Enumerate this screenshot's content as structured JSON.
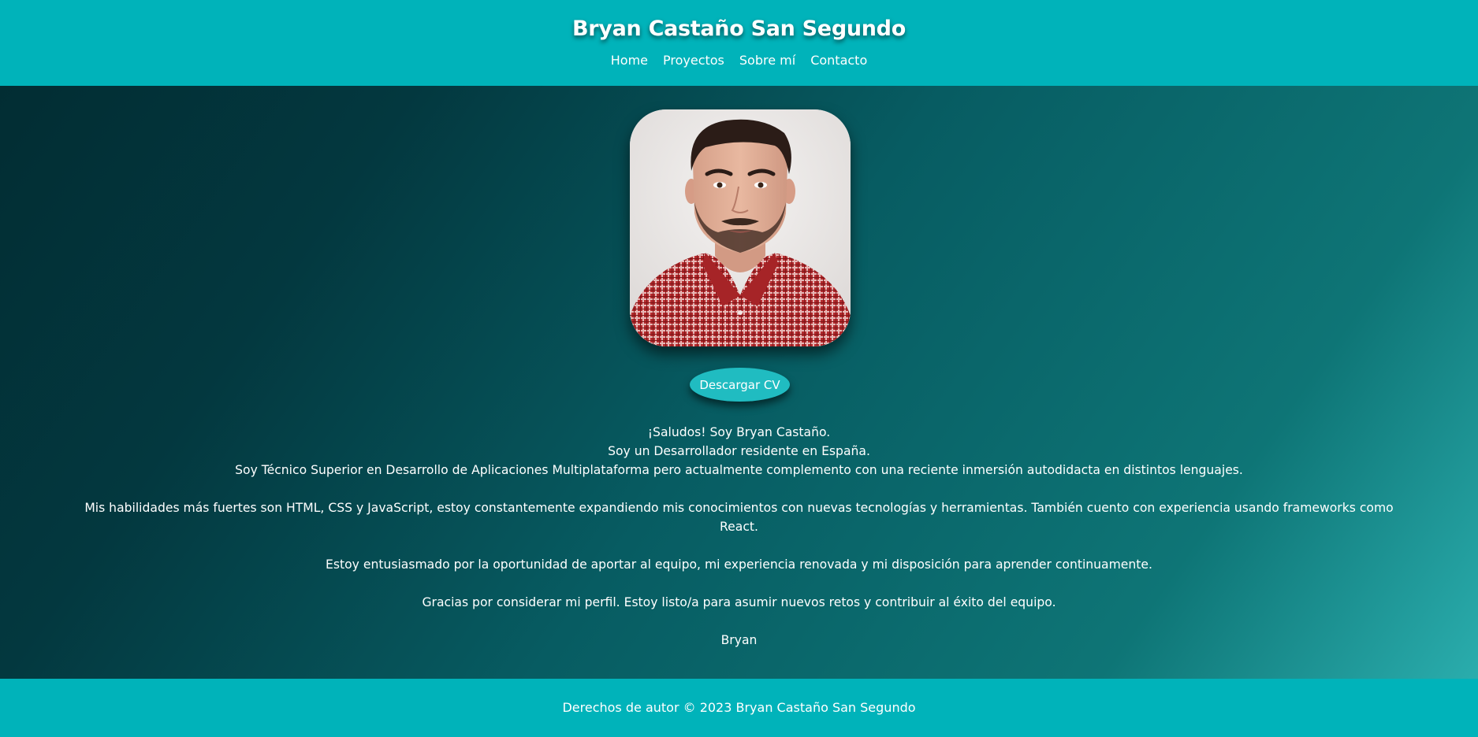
{
  "header": {
    "title": "Bryan Castaño San Segundo",
    "nav": [
      "Home",
      "Proyectos",
      "Sobre mí",
      "Contacto"
    ]
  },
  "main": {
    "cv_button": "Descargar CV",
    "intro": [
      "¡Saludos! Soy Bryan Castaño.",
      "Soy un Desarrollador residente en España.",
      "Soy Técnico Superior en Desarrollo de Aplicaciones Multiplataforma pero actualmente complemento con una reciente inmersión autodidacta en distintos lenguajes."
    ],
    "skills": "Mis habilidades más fuertes son HTML, CSS y JavaScript, estoy constantemente expandiendo mis conocimientos con nuevas tecnologías y herramientas. También cuento con experiencia usando frameworks como React.",
    "enthusiasm": "Estoy entusiasmado por la oportunidad de aportar al equipo, mi experiencia renovada y mi disposición para aprender continuamente.",
    "thanks": "Gracias por considerar mi perfil. Estoy listo/a para asumir nuevos retos y contribuir al éxito del equipo.",
    "signature": "Bryan"
  },
  "footer": {
    "copyright": "Derechos de autor © 2023 Bryan Castaño San Segundo"
  },
  "colors": {
    "header_bg": "#00b3ba",
    "button_bg": "#20bcc1",
    "shirt_red": "#b02a2c"
  }
}
